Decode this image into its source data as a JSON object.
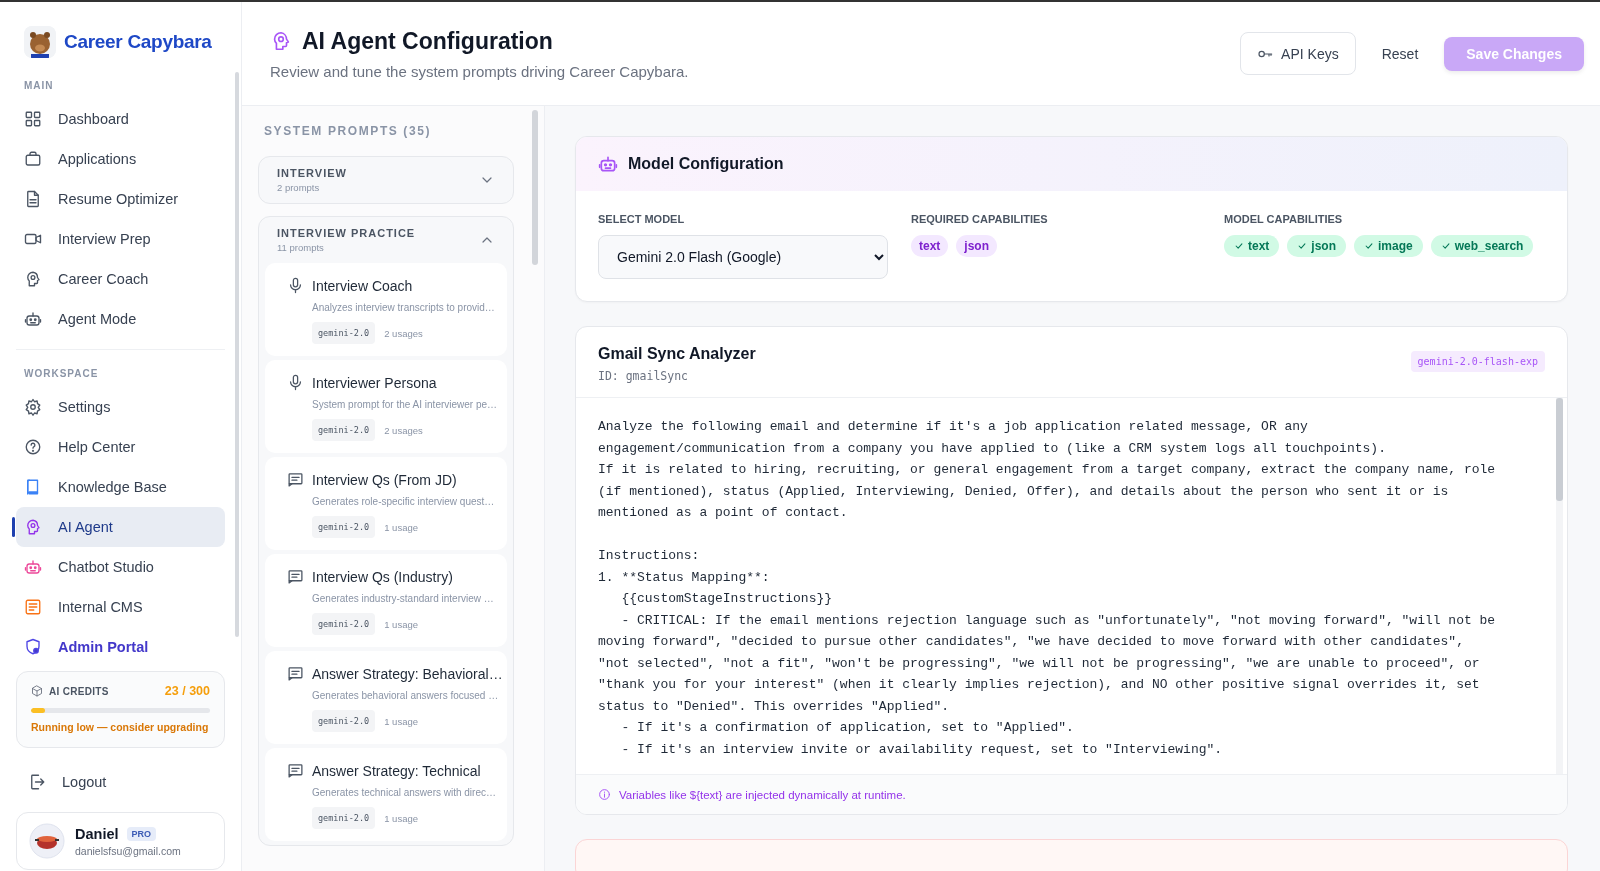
{
  "sidebar": {
    "brand": "Career Capybara",
    "sections": [
      {
        "title": "MAIN",
        "items": [
          {
            "label": "Dashboard",
            "selected": false,
            "emphasized": false
          },
          {
            "label": "Applications",
            "selected": false,
            "emphasized": false
          },
          {
            "label": "Resume Optimizer",
            "selected": false,
            "emphasized": false
          },
          {
            "label": "Interview Prep",
            "selected": false,
            "emphasized": false
          },
          {
            "label": "Career Coach",
            "selected": false,
            "emphasized": false
          },
          {
            "label": "Agent Mode",
            "selected": false,
            "emphasized": false
          }
        ]
      },
      {
        "title": "WORKSPACE",
        "items": [
          {
            "label": "Settings",
            "selected": false,
            "emphasized": false
          },
          {
            "label": "Help Center",
            "selected": false,
            "emphasized": false
          },
          {
            "label": "Knowledge Base",
            "selected": false,
            "emphasized": false
          },
          {
            "label": "AI Agent",
            "selected": true,
            "emphasized": false
          },
          {
            "label": "Chatbot Studio",
            "selected": false,
            "emphasized": false
          },
          {
            "label": "Internal CMS",
            "selected": false,
            "emphasized": false
          },
          {
            "label": "Admin Portal",
            "selected": false,
            "emphasized": true
          }
        ]
      }
    ],
    "credits": {
      "label": "AI CREDITS",
      "count": "23 / 300",
      "level": 0.077,
      "warning": "Running low — consider upgrading"
    },
    "logout": "Logout",
    "user": {
      "name": "Daniel",
      "badge": "PRO",
      "email": "danielsfsu@gmail.com"
    }
  },
  "header": {
    "title": "AI Agent Configuration",
    "subtitle": "Review and tune the system prompts driving Career Capybara.",
    "buttons": [
      {
        "label": "API Keys",
        "kind": "outline",
        "disabled": false
      },
      {
        "label": "Reset",
        "kind": "plain",
        "disabled": false
      },
      {
        "label": "Save Changes",
        "kind": "primary",
        "disabled": true
      }
    ]
  },
  "prompts": {
    "title": "SYSTEM PROMPTS (35)",
    "groups": [
      {
        "name": "INTERVIEW",
        "count": "2 prompts",
        "expanded": false
      },
      {
        "name": "INTERVIEW PRACTICE",
        "count": "11 prompts",
        "expanded": true,
        "items": [
          {
            "kind": "voice",
            "title": "Interview Coach",
            "description": "Analyzes interview transcripts to provid…",
            "model": "gemini-2.0",
            "usage": "2 usages"
          },
          {
            "kind": "voice",
            "title": "Interviewer Persona",
            "description": "System prompt for the AI interviewer pe…",
            "model": "gemini-2.0",
            "usage": "2 usages"
          },
          {
            "kind": "text",
            "title": "Interview Qs (From JD)",
            "description": "Generates role-specific interview quest…",
            "model": "gemini-2.0",
            "usage": "1 usage"
          },
          {
            "kind": "text",
            "title": "Interview Qs (Industry)",
            "description": "Generates industry-standard interview …",
            "model": "gemini-2.0",
            "usage": "1 usage"
          },
          {
            "kind": "text",
            "title": "Answer Strategy: Behavioral…",
            "description": "Generates behavioral answers focused …",
            "model": "gemini-2.0",
            "usage": "1 usage"
          },
          {
            "kind": "text",
            "title": "Answer Strategy: Technical",
            "description": "Generates technical answers with direc…",
            "model": "gemini-2.0",
            "usage": "1 usage"
          }
        ]
      }
    ]
  },
  "model_config": {
    "title": "Model Configuration",
    "select_label": "SELECT MODEL",
    "select_value": "Gemini 2.0 Flash (Google)",
    "required_label": "REQUIRED CAPABILITIES",
    "required": [
      "text",
      "json"
    ],
    "capabilities_label": "MODEL CAPABILITIES",
    "capabilities": [
      "text",
      "json",
      "image",
      "web_search"
    ]
  },
  "editor": {
    "title": "Gmail Sync Analyzer",
    "id": "ID: gmailSync",
    "model": "gemini-2.0-flash-exp",
    "prompt": "Analyze the following email and determine if it's a job application related message, OR any engagement/communication from a company you have applied to (like a CRM system logs all touchpoints).\nIf it is related to hiring, recruiting, or general engagement from a target company, extract the company name, role (if mentioned), status (Applied, Interviewing, Denied, Offer), and details about the person who sent it or is mentioned as a point of contact.\n\nInstructions:\n1. **Status Mapping**:\n   {{customStageInstructions}}\n   - CRITICAL: If the email mentions rejection language such as \"unfortunately\", \"not moving forward\", \"will not be moving forward\", \"decided to pursue other candidates\", \"we have decided to move forward with other candidates\", \"not selected\", \"not a fit\", \"won't be progressing\", \"we will not be progressing\", \"we are unable to proceed\", or \"thank you for your interest\" (when it clearly implies rejection), and NO other positive signal overrides it, set status to \"Denied\". This overrides \"Applied\".\n   - If it's a confirmation of application, set to \"Applied\".\n   - If it's an interview invite or availability request, set to \"Interviewing\".",
    "note": "Variables like ${text} are injected dynamically at runtime."
  }
}
